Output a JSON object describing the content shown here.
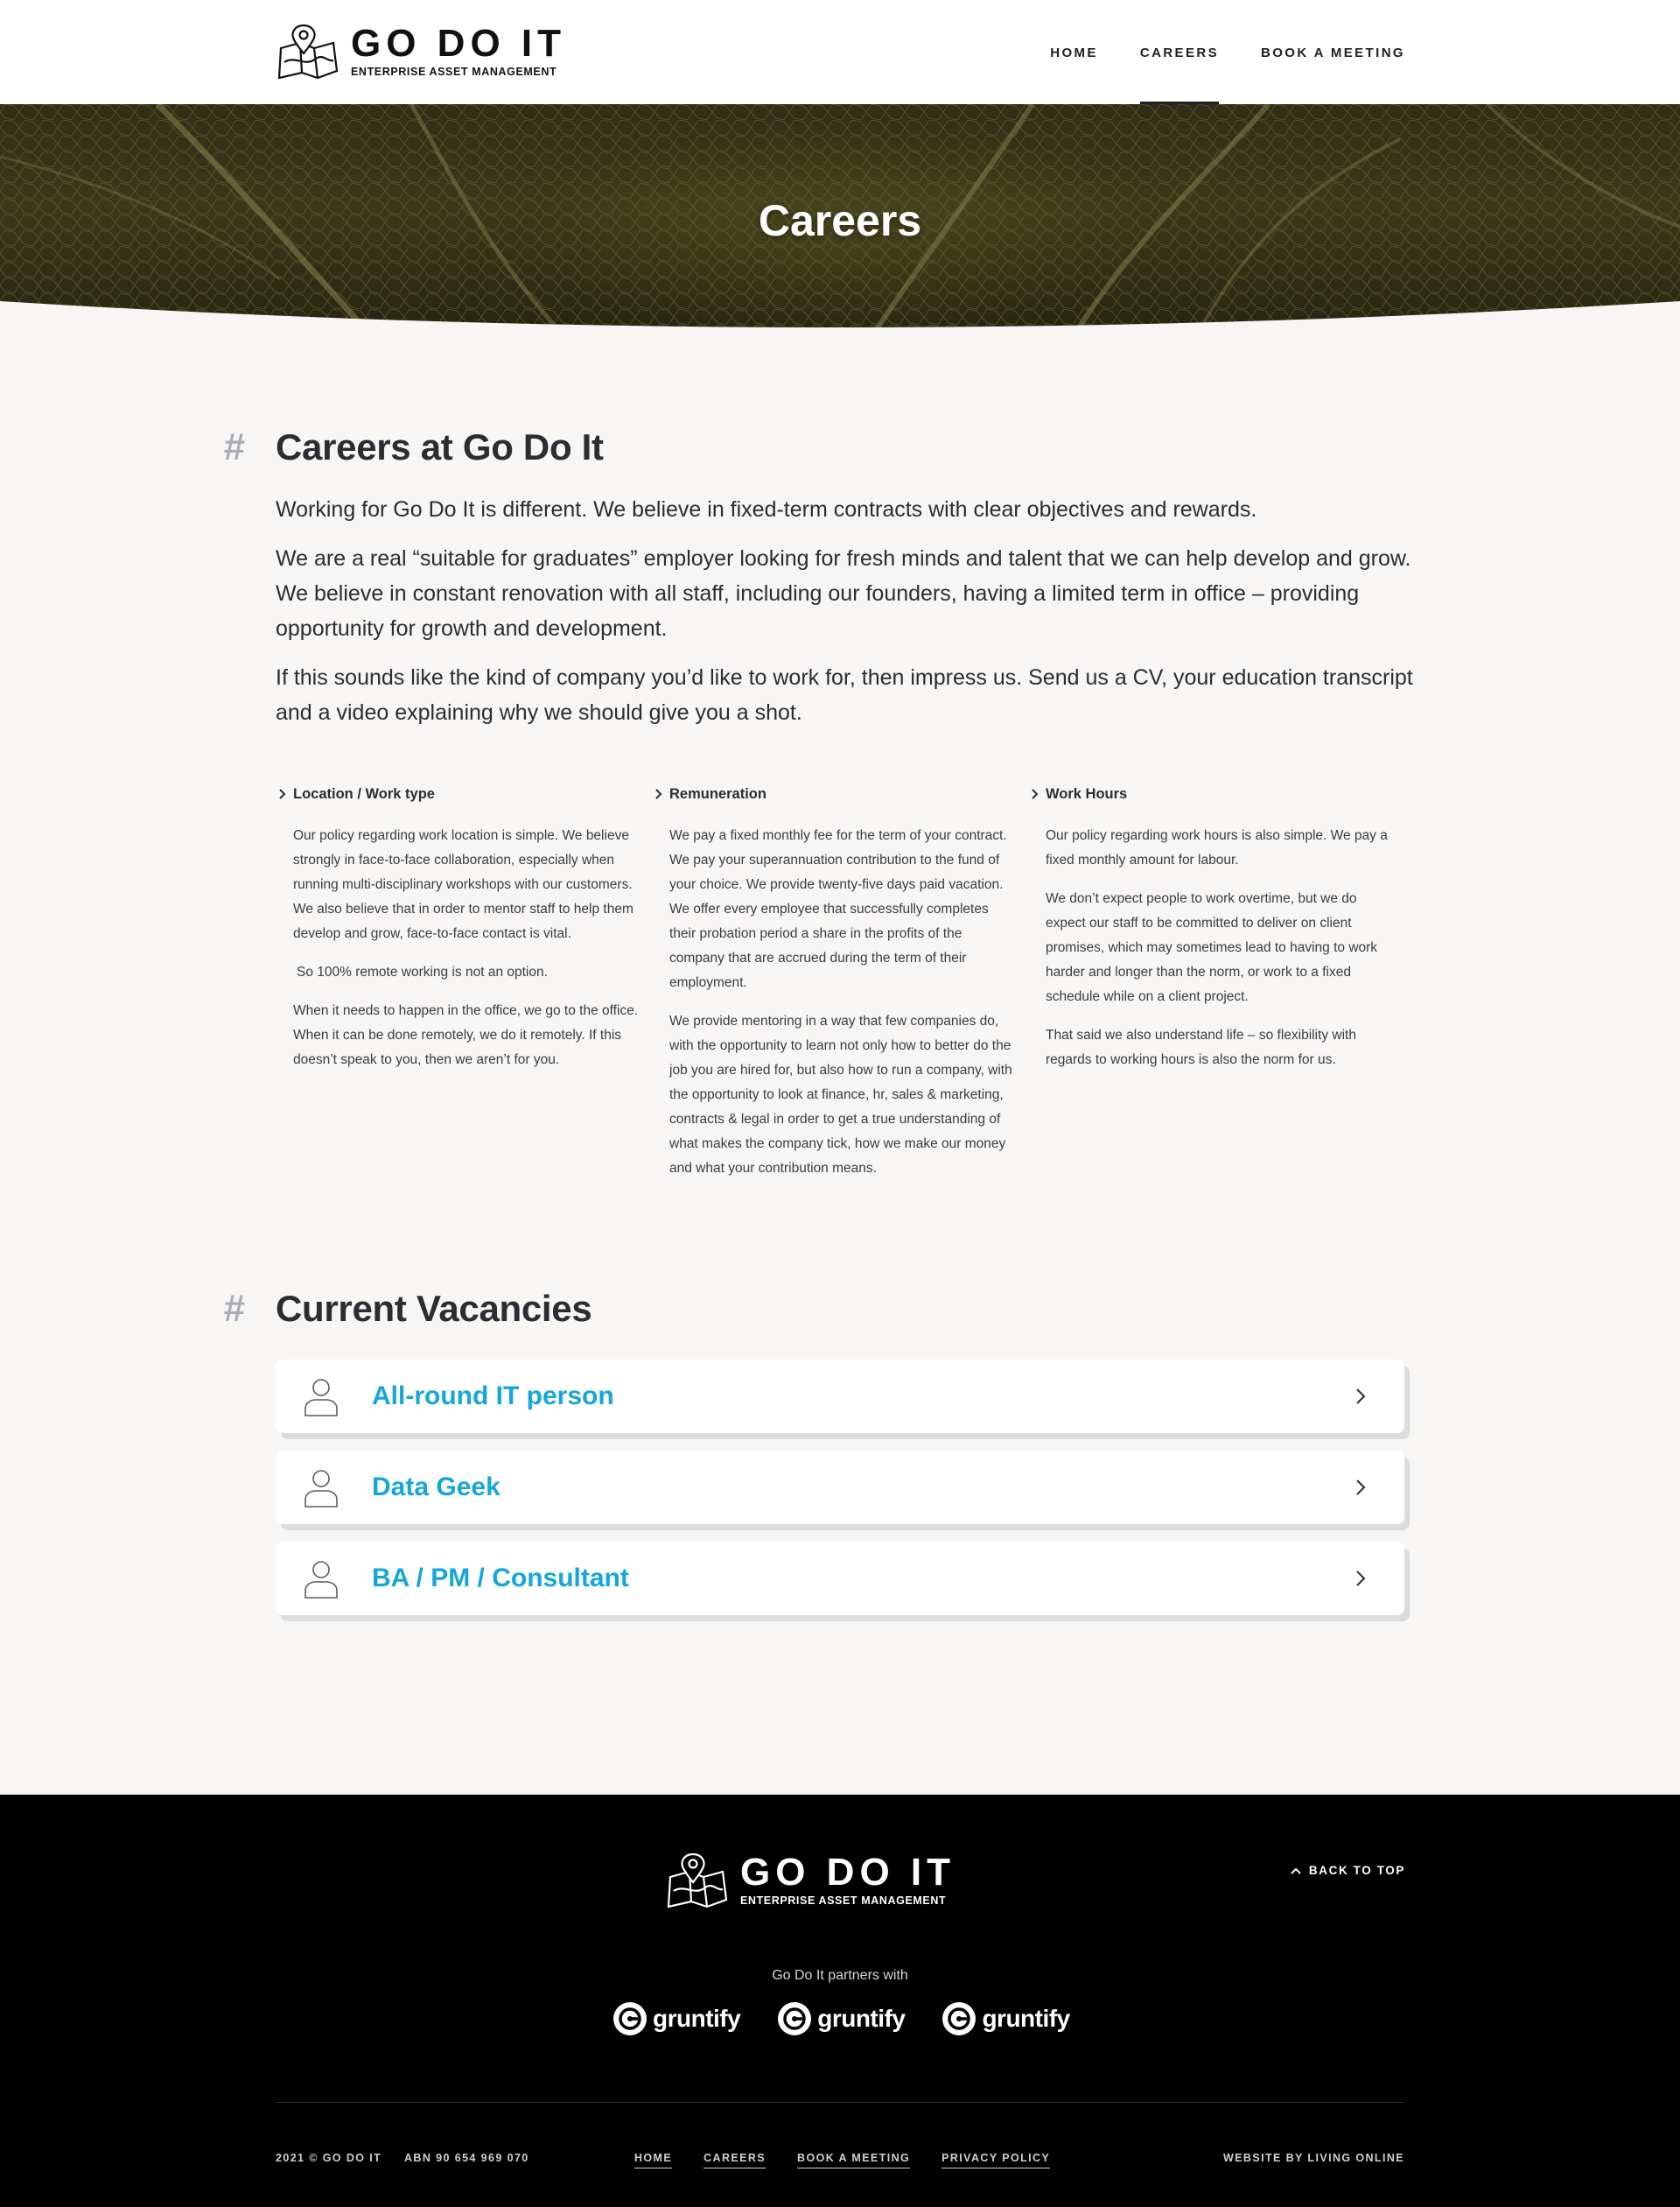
{
  "brand": {
    "name": "GO DO IT",
    "tagline": "ENTERPRISE ASSET MANAGEMENT"
  },
  "nav": [
    {
      "label": "HOME"
    },
    {
      "label": "CAREERS"
    },
    {
      "label": "BOOK A MEETING"
    }
  ],
  "hero": {
    "title": "Careers"
  },
  "careers": {
    "heading": "Careers at Go Do It",
    "paragraphs": [
      "Working for Go Do It is different. We believe in fixed-term contracts with clear objectives and rewards.",
      "We are a real “suitable for graduates” employer looking for fresh minds and talent that we can help develop and grow. We believe in constant renovation with all staff, including our founders, having a limited term in office – providing opportunity for growth and development.",
      "If this sounds like the kind of company you’d like to work for, then impress us. Send us a CV, your education transcript and a video explaining why we should give you a shot."
    ]
  },
  "columns": [
    {
      "title": "Location / Work type",
      "paragraphs": [
        "Our policy regarding work location is simple. We believe strongly in face-to-face collaboration, especially when running multi-disciplinary workshops with our customers. We also believe that in order to mentor staff to help them develop and grow, face-to-face contact is vital.",
        "So 100% remote working is not an option.",
        "When it needs to happen in the office, we go to the office. When it can be done remotely, we do it remotely. If this doesn’t speak to you, then we aren’t for you."
      ]
    },
    {
      "title": "Remuneration",
      "paragraphs": [
        "We pay a fixed monthly fee for the term of your contract. We pay your superannuation contribution to the fund of your choice. We provide twenty-five days paid vacation. We offer every employee that successfully completes their probation period a share in the profits of the company that are accrued during the term of their employment.",
        "We provide mentoring in a way that few companies do, with the opportunity to learn not only how to better do the job you are hired for, but also how to run a company, with the opportunity to look at finance, hr, sales & marketing, contracts & legal in order to get a true understanding of what makes the company tick, how we make our money and what your contribution means."
      ]
    },
    {
      "title": "Work Hours",
      "paragraphs": [
        "Our policy regarding work hours is also simple. We pay a fixed monthly amount for labour.",
        "We don’t expect people to work overtime, but we do expect our staff to be committed to deliver on client promises, which may sometimes lead to having to  work harder and longer than the norm, or work to a fixed schedule while on a client project.",
        "That said we also understand life – so flexibility with regards to working hours is also the norm for us."
      ]
    }
  ],
  "vacancies": {
    "heading": "Current Vacancies",
    "items": [
      {
        "title": "All-round IT person"
      },
      {
        "title": "Data Geek"
      },
      {
        "title": "BA / PM / Consultant"
      }
    ]
  },
  "footer": {
    "back_to_top": "BACK TO TOP",
    "partners_label": "Go Do It partners with",
    "partners": [
      {
        "name": "gruntify"
      },
      {
        "name": "gruntify"
      },
      {
        "name": "gruntify"
      }
    ],
    "copyright": "2021 © GO DO IT",
    "abn": "ABN 90 654 969 070",
    "links": [
      {
        "label": "HOME"
      },
      {
        "label": "CAREERS"
      },
      {
        "label": "BOOK A MEETING"
      },
      {
        "label": "PRIVACY POLICY"
      }
    ],
    "credit": "WEBSITE BY LIVING ONLINE"
  },
  "colors": {
    "accent": "#16a6d9",
    "text": "#2b2d33",
    "background": "#f7f6f4",
    "footer": "#000000"
  },
  "icons": [
    "map-pin-logo-icon",
    "chevron-right-icon",
    "person-icon",
    "chevron-up-icon",
    "gruntify-logo-icon"
  ]
}
